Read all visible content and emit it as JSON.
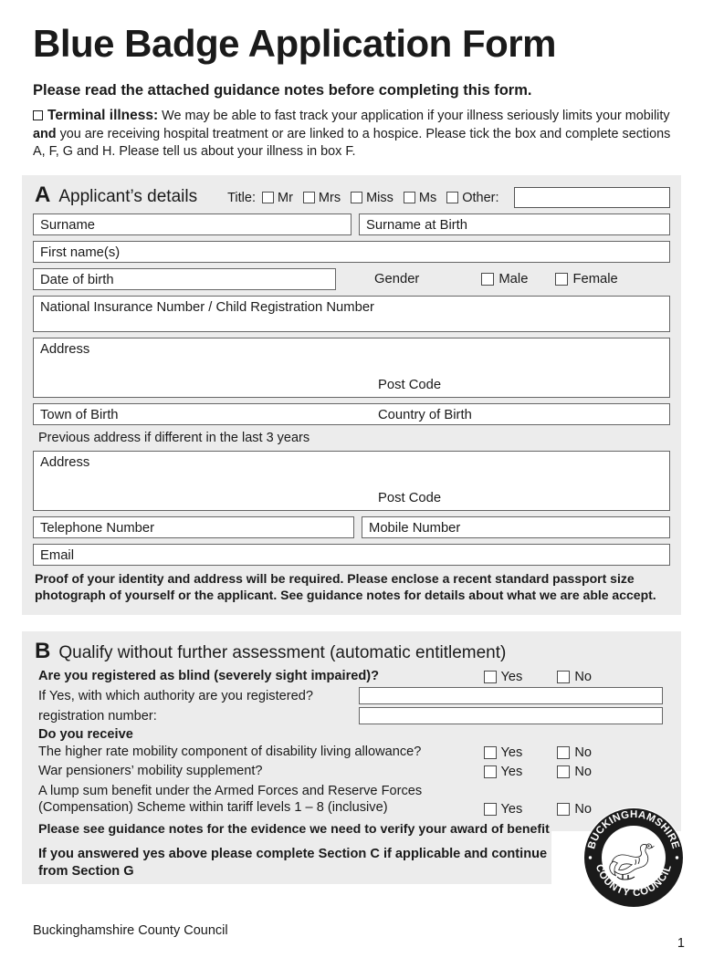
{
  "document": {
    "title": "Blue Badge Application Form",
    "guidance_line": "Please read the attached guidance notes before completing this form.",
    "terminal_illness_label": "Terminal illness:",
    "terminal_illness_text_1": " We may be able to fast track your application if your illness seriously limits your mobility ",
    "terminal_illness_bold": "and",
    "terminal_illness_text_2": " you are receiving hospital treatment or are linked to a hospice. Please tick the box and complete sections A, F, G and H. Please tell us about your illness in box F."
  },
  "section_a": {
    "letter": "A",
    "title": "Applicant’s details",
    "title_field_label": "Title:",
    "title_options": [
      "Mr",
      "Mrs",
      "Miss",
      "Ms"
    ],
    "other_label": "Other:",
    "other_value": "",
    "fields": {
      "surname": "Surname",
      "surname_at_birth": "Surname at Birth",
      "first_names": "First name(s)",
      "date_of_birth": "Date of birth",
      "gender_label": "Gender",
      "gender_male": "Male",
      "gender_female": "Female",
      "ni_number": "National Insurance Number / Child Registration Number",
      "address": "Address",
      "post_code": "Post Code",
      "town_of_birth": "Town of Birth",
      "country_of_birth": "Country of Birth",
      "previous_address_note": "Previous address if different in the last 3 years",
      "previous_address": "Address",
      "previous_post_code": "Post Code",
      "telephone": "Telephone Number",
      "mobile": "Mobile Number",
      "email": "Email"
    },
    "proof_note": "Proof of your identity and address will be required. Please enclose a recent standard passport size photograph of yourself or the applicant. See guidance notes for details about what we are able accept."
  },
  "section_b": {
    "letter": "B",
    "title": "Qualify without further assessment (automatic entitlement)",
    "blind_question": "Are you registered as blind (severely sight impaired)?",
    "authority_question": "If Yes, with which authority are you registered?",
    "authority_value": "",
    "registration_number_label": "registration number:",
    "registration_number_value": "",
    "do_you_receive": "Do you receive",
    "benefit_questions": [
      "The higher rate mobility component of disability living allowance?",
      "War pensioners’ mobility supplement?"
    ],
    "lump_sum_line_1": "A lump sum benefit under the Armed Forces and Reserve Forces",
    "lump_sum_line_2": "(Compensation) Scheme within tariff levels 1 – 8 (inclusive)",
    "yes_label": "Yes",
    "no_label": "No",
    "evidence_note": "Please see guidance notes for the evidence we need to verify your award of benefit",
    "continue_note": "If you answered yes above please complete Section C if applicable and continue from Section G"
  },
  "logo": {
    "top_text": "BUCKINGHAMSHIRE",
    "bottom_text": "COUNTY COUNCIL"
  },
  "footer": {
    "organisation": "Buckinghamshire County Council",
    "page_number": "1"
  }
}
